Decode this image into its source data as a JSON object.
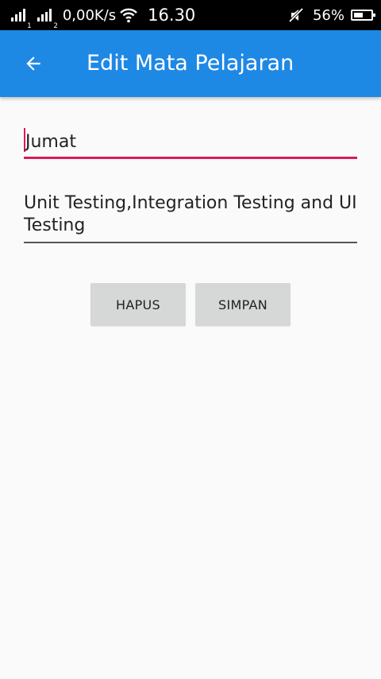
{
  "status_bar": {
    "sim1_label": "1",
    "sim2_label": "2",
    "net_speed": "0,00K/s",
    "time": "16.30",
    "battery_percent": "56%",
    "battery_level": 0.56,
    "icons": [
      "signal-icon",
      "signal-icon",
      "wifi-icon",
      "mute-icon",
      "battery-icon"
    ]
  },
  "app_bar": {
    "back_icon": "arrow-back-icon",
    "title": "Edit Mata Pelajaran",
    "color": "#1e88e5"
  },
  "form": {
    "day_value": "Jumat",
    "subject_value": "Unit Testing,Integration Testing and UI Testing",
    "focus_color": "#d81b60"
  },
  "buttons": {
    "delete_label": "HAPUS",
    "save_label": "SIMPAN"
  }
}
